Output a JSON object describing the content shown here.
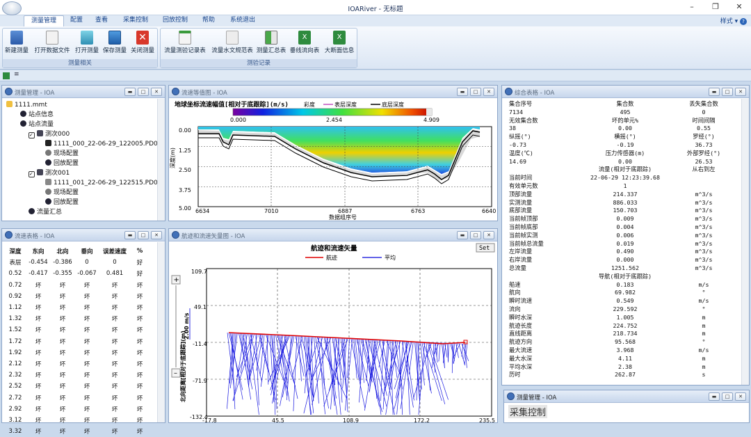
{
  "app": {
    "title": "IOARiver - 无标题",
    "styles": "样式"
  },
  "menu": [
    "测量管理",
    "配置",
    "查看",
    "采集控制",
    "回放控制",
    "帮助",
    "系统退出"
  ],
  "ribbon": {
    "group1": {
      "label": "测量相关",
      "buttons": [
        "新建测量",
        "打开数据文件",
        "打开测量",
        "保存测量",
        "关闭测量"
      ]
    },
    "group2": {
      "label": "测验记录",
      "buttons": [
        "流量测验记录表",
        "流量水文规范表",
        "测量汇总表",
        "垂线流向表",
        "大断面信息"
      ]
    }
  },
  "tree_panel": {
    "title": "测量管理 - IOA",
    "items": [
      "1111.mmt",
      "站点信息",
      "站点流量",
      "测次000",
      "1111_000_22-06-29_122005.PD0",
      "现场配置",
      "回放配置",
      "测次001",
      "1111_001_22-06-29_122515.PD0",
      "现场配置",
      "回放配置",
      "流量汇总"
    ]
  },
  "contour_panel": {
    "title": "流速等值图 - IOA",
    "chart_title": "地球坐标流速幅值[相对于底跟踪](m/s)",
    "legend": [
      "彩度",
      "表层深度",
      "底层深度"
    ],
    "scale": [
      "0.000",
      "2.454",
      "4.909"
    ],
    "yticks": [
      "0.00",
      "1.25",
      "2.50",
      "3.75",
      "5.00"
    ],
    "xticks": [
      "6634",
      "7010",
      "6887",
      "6763",
      "6640"
    ],
    "xlabel": "数据组序号",
    "ylabel": "深度(m)"
  },
  "speed_panel": {
    "title": "流速表格 - IOA",
    "headers": [
      "深度",
      "东向",
      "北向",
      "垂向",
      "误差速度",
      "%"
    ],
    "rows": [
      [
        "表层",
        "-0.454",
        "-0.386",
        "0",
        "0",
        "好"
      ],
      [
        "0.52",
        "-0.417",
        "-0.355",
        "-0.067",
        "0.481",
        "好"
      ],
      [
        "0.72",
        "坏",
        "坏",
        "坏",
        "坏",
        "坏"
      ],
      [
        "0.92",
        "坏",
        "坏",
        "坏",
        "坏",
        "坏"
      ],
      [
        "1.12",
        "坏",
        "坏",
        "坏",
        "坏",
        "坏"
      ],
      [
        "1.32",
        "坏",
        "坏",
        "坏",
        "坏",
        "坏"
      ],
      [
        "1.52",
        "坏",
        "坏",
        "坏",
        "坏",
        "坏"
      ],
      [
        "1.72",
        "坏",
        "坏",
        "坏",
        "坏",
        "坏"
      ],
      [
        "1.92",
        "坏",
        "坏",
        "坏",
        "坏",
        "坏"
      ],
      [
        "2.12",
        "坏",
        "坏",
        "坏",
        "坏",
        "坏"
      ],
      [
        "2.32",
        "坏",
        "坏",
        "坏",
        "坏",
        "坏"
      ],
      [
        "2.52",
        "坏",
        "坏",
        "坏",
        "坏",
        "坏"
      ],
      [
        "2.72",
        "坏",
        "坏",
        "坏",
        "坏",
        "坏"
      ],
      [
        "2.92",
        "坏",
        "坏",
        "坏",
        "坏",
        "坏"
      ],
      [
        "3.12",
        "坏",
        "坏",
        "坏",
        "坏",
        "坏"
      ],
      [
        "3.32",
        "坏",
        "坏",
        "坏",
        "坏",
        "坏"
      ]
    ]
  },
  "track_panel": {
    "title": "航迹和流速矢量图 - IOA",
    "chart_title": "航迹和流速矢量",
    "set": "Set",
    "legend": [
      "航迹",
      "平均"
    ],
    "scale": "2.00 m/s",
    "yticks": [
      "109.7",
      "49.1",
      "-11.4",
      "-71.9",
      "-132.4"
    ],
    "xticks": [
      "-17.8",
      "45.5",
      "108.9",
      "172.2",
      "235.5"
    ],
    "ylabel": "北向距离[相对于底跟踪](m)"
  },
  "summary_panel": {
    "title": "综合表格 - IOA",
    "rows": [
      [
        "集合序号",
        "集合数",
        "丢失集合数"
      ],
      [
        "7134",
        "495",
        "0"
      ],
      [
        "无效集合数",
        "坏的单元%",
        "时间间隔"
      ],
      [
        "38",
        "0.00",
        "0.55"
      ],
      [
        "纵摇(°)",
        "横摇(°)",
        "罗经(°)"
      ],
      [
        "-0.73",
        "-0.19",
        "36.73"
      ],
      [
        "温度(℃)",
        "压力传感器(m)",
        "外部罗经(°)"
      ],
      [
        "14.69",
        "0.00",
        "26.53"
      ],
      [
        "",
        "流量(相对于底跟踪)",
        "从右到左"
      ],
      [
        "当前时间",
        "22-06-29 12:23:39.68",
        ""
      ],
      [
        "有效单元数",
        "1",
        ""
      ],
      [
        "顶部流量",
        "214.337",
        "m^3/s"
      ],
      [
        "实测流量",
        "886.033",
        "m^3/s"
      ],
      [
        "底部流量",
        "150.703",
        "m^3/s"
      ],
      [
        "当前帧顶部",
        "0.009",
        "m^3/s"
      ],
      [
        "当前帧底部",
        "0.004",
        "m^3/s"
      ],
      [
        "当前帧实测",
        "0.006",
        "m^3/s"
      ],
      [
        "当前帧总流量",
        "0.019",
        "m^3/s"
      ],
      [
        "左岸流量",
        "0.490",
        "m^3/s"
      ],
      [
        "右岸流量",
        "0.000",
        "m^3/s"
      ],
      [
        "总流量",
        "1251.562",
        "m^3/s"
      ],
      [
        "",
        "导航(相对于底跟踪)",
        ""
      ],
      [
        "船速",
        "0.183",
        "m/s"
      ],
      [
        "航向",
        "69.982",
        "°"
      ],
      [
        "瞬时流速",
        "0.549",
        "m/s"
      ],
      [
        "流向",
        "229.592",
        "°"
      ],
      [
        "瞬时水深",
        "1.005",
        "m"
      ],
      [
        "航迹长度",
        "224.752",
        "m"
      ],
      [
        "直线距离",
        "218.734",
        "m"
      ],
      [
        "航迹方向",
        "95.568",
        "°"
      ],
      [
        "最大流速",
        "3.968",
        "m/s"
      ],
      [
        "最大水深",
        "4.11",
        "m"
      ],
      [
        "平均水深",
        "2.38",
        "m"
      ],
      [
        "历时",
        "262.87",
        "s"
      ]
    ]
  },
  "ctrl_panel": {
    "title": "测量管理 - IOA",
    "heading": "采集控制"
  }
}
